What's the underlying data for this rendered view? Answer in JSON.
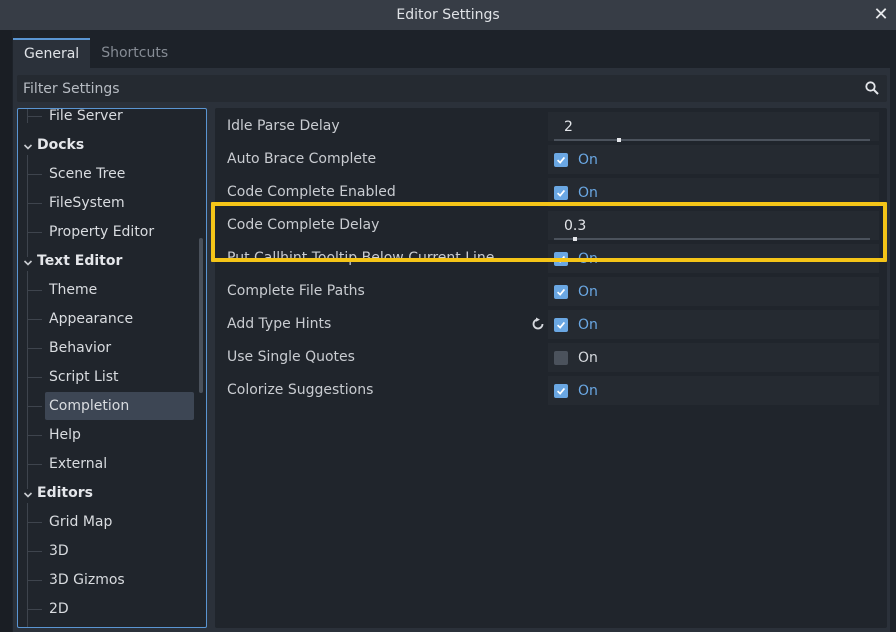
{
  "window": {
    "title": "Editor Settings",
    "close_icon": "close-icon"
  },
  "tabs": [
    {
      "label": "General",
      "active": true
    },
    {
      "label": "Shortcuts",
      "active": false
    }
  ],
  "filter": {
    "placeholder": "Filter Settings",
    "icon": "search-icon"
  },
  "tree": {
    "items": [
      {
        "label": "File Server",
        "type": "child"
      },
      {
        "label": "Docks",
        "type": "section"
      },
      {
        "label": "Scene Tree",
        "type": "child"
      },
      {
        "label": "FileSystem",
        "type": "child"
      },
      {
        "label": "Property Editor",
        "type": "child"
      },
      {
        "label": "Text Editor",
        "type": "section"
      },
      {
        "label": "Theme",
        "type": "child"
      },
      {
        "label": "Appearance",
        "type": "child"
      },
      {
        "label": "Behavior",
        "type": "child"
      },
      {
        "label": "Script List",
        "type": "child"
      },
      {
        "label": "Completion",
        "type": "child",
        "selected": true
      },
      {
        "label": "Help",
        "type": "child"
      },
      {
        "label": "External",
        "type": "child"
      },
      {
        "label": "Editors",
        "type": "section"
      },
      {
        "label": "Grid Map",
        "type": "child"
      },
      {
        "label": "3D",
        "type": "child"
      },
      {
        "label": "3D Gizmos",
        "type": "child"
      },
      {
        "label": "2D",
        "type": "child"
      }
    ]
  },
  "settings": [
    {
      "name": "Idle Parse Delay",
      "kind": "number",
      "value": "2",
      "fraction": 0.2
    },
    {
      "name": "Auto Brace Complete",
      "kind": "bool",
      "checked": true,
      "value_label": "On"
    },
    {
      "name": "Code Complete Enabled",
      "kind": "bool",
      "checked": true,
      "value_label": "On"
    },
    {
      "name": "Code Complete Delay",
      "kind": "number",
      "value": "0.3",
      "fraction": 0.06,
      "highlighted": true
    },
    {
      "name": "Put Callhint Tooltip Below Current Line",
      "kind": "bool",
      "checked": true,
      "value_label": "On"
    },
    {
      "name": "Complete File Paths",
      "kind": "bool",
      "checked": true,
      "value_label": "On"
    },
    {
      "name": "Add Type Hints",
      "kind": "bool",
      "checked": true,
      "value_label": "On",
      "revert_icon": "revert-icon"
    },
    {
      "name": "Use Single Quotes",
      "kind": "bool",
      "checked": false,
      "value_label": "On"
    },
    {
      "name": "Colorize Suggestions",
      "kind": "bool",
      "checked": true,
      "value_label": "On"
    }
  ],
  "colors": {
    "accent": "#5a95d2",
    "checked": "#6aa7e3",
    "highlight": "#f5c518"
  }
}
